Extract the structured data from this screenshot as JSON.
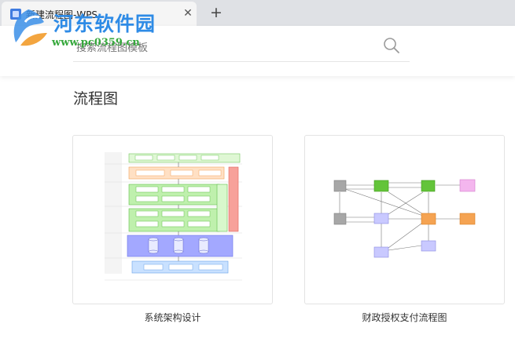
{
  "tab": {
    "title": "新建流程图-WPS",
    "close_label": "✕",
    "new_label": "+"
  },
  "watermark": {
    "title": "河东软件园",
    "url": "www.pc0359.cn"
  },
  "search": {
    "placeholder": "搜索流程图模板",
    "icon": "search-icon"
  },
  "section": {
    "title": "流程图"
  },
  "templates": [
    {
      "name": "系统架构设计",
      "thumbnail": "architecture-diagram"
    },
    {
      "name": "财政授权支付流程图",
      "thumbnail": "payment-flowchart"
    }
  ],
  "colors": {
    "tabbar": "#dfe1e5",
    "brand_blue": "#2e8be6",
    "brand_green": "#36a83c",
    "layer_blue": "#8aa9ff",
    "layer_green": "#9fe28a",
    "layer_peach": "#ffcfa8",
    "layer_red": "#f79a94"
  }
}
